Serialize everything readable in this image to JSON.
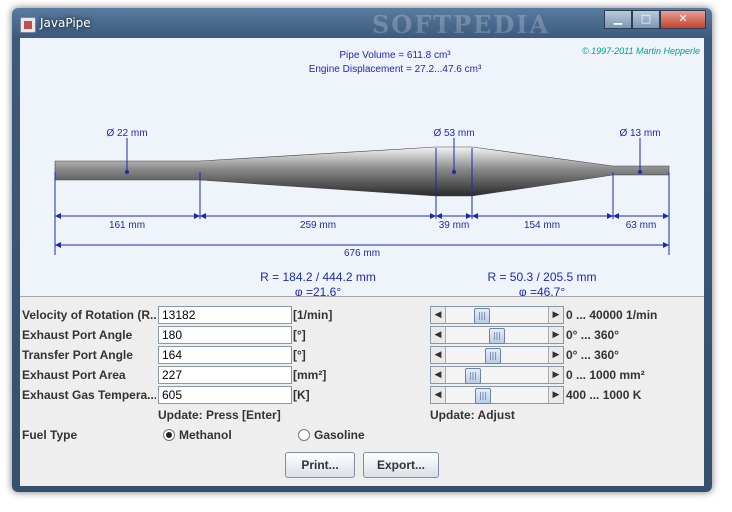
{
  "window": {
    "title": "JavaPipe",
    "watermark": "SOFTPEDIA"
  },
  "header": {
    "pipe_volume": "Pipe Volume = 611.8 cm³",
    "engine_displacement": "Engine Displacement = 27.2...47.6 cm³",
    "copyright": "© 1997-2011 Martin Hepperle"
  },
  "diagram": {
    "diameters": [
      "Ø 22 mm",
      "Ø 53 mm",
      "Ø 13 mm"
    ],
    "segment_lengths": [
      "161 mm",
      "259 mm",
      "39 mm",
      "154 mm",
      "63 mm"
    ],
    "total_length": "676 mm",
    "cone1": {
      "radius": "R = 184.2 / 444.2 mm",
      "angle": "φ =21.6°"
    },
    "cone2": {
      "radius": "R = 50.3 / 205.5 mm",
      "angle": "φ =46.7°"
    }
  },
  "form": {
    "rows": [
      {
        "label": "Velocity of Rotation (R...",
        "value": "13182",
        "unit": "[1/min]",
        "range": "0 ... 40000 1/min",
        "slider_fraction": 0.33
      },
      {
        "label": "Exhaust Port Angle",
        "value": "180",
        "unit": "[°]",
        "range": "0° ... 360°",
        "slider_fraction": 0.5
      },
      {
        "label": "Transfer Port Angle",
        "value": "164",
        "unit": "[°]",
        "range": "0° ... 360°",
        "slider_fraction": 0.46
      },
      {
        "label": "Exhaust Port Area",
        "value": "227",
        "unit": "[mm²]",
        "range": "0 ... 1000 mm²",
        "slider_fraction": 0.23
      },
      {
        "label": "Exhaust Gas Tempera...",
        "value": "605",
        "unit": "[K]",
        "range": "400 ... 1000 K",
        "slider_fraction": 0.34
      }
    ],
    "update_press": "Update: Press [Enter]",
    "update_adjust": "Update: Adjust",
    "fuel_type_label": "Fuel Type",
    "fuel_options": [
      "Methanol",
      "Gasoline"
    ],
    "fuel_selected": "Methanol"
  },
  "buttons": {
    "print": "Print...",
    "export": "Export..."
  }
}
